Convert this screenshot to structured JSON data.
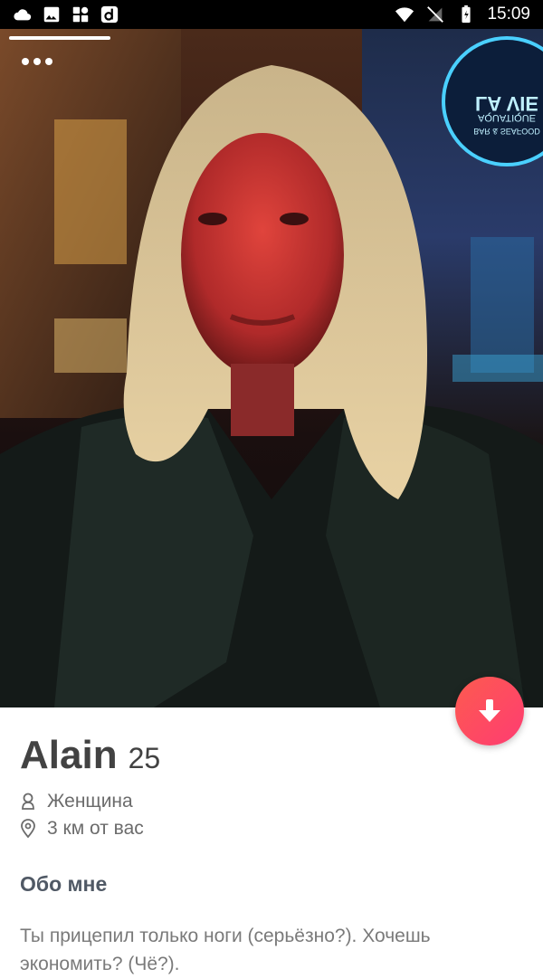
{
  "status_bar": {
    "time": "15:09",
    "icons": [
      "cloud-icon",
      "gallery-icon",
      "dashboard-icon",
      "app-d-icon",
      "wifi-icon",
      "no-sim-icon",
      "battery-icon"
    ]
  },
  "profile": {
    "name": "Alain",
    "age": "25",
    "gender": "Женщина",
    "distance": "3 км от вас",
    "about_title": "Обо мне",
    "about_text": "Ты прицепил только ноги (серьёзно?). Хочешь экономить? (Чё?)."
  },
  "photo": {
    "description_icons": [
      "more-options-icon"
    ],
    "neon_sign_lines": [
      "LA VIE",
      "AQUATIQUE",
      "BAR & SEAFOOD"
    ]
  },
  "colors": {
    "accent_start": "#fd5b4f",
    "accent_end": "#fe3c72",
    "name_text": "#424242",
    "secondary_text": "#7a7a7a"
  }
}
